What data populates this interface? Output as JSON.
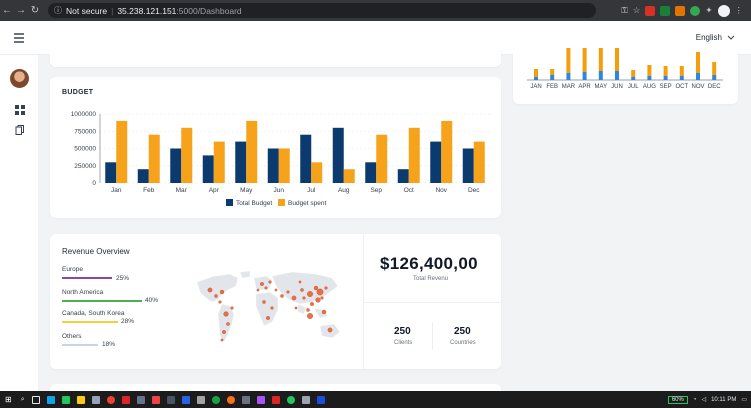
{
  "browser": {
    "security_label": "Not secure",
    "host": "35.238.121.151",
    "path": ":5000/Dashboard"
  },
  "topbar": {
    "language": "English"
  },
  "monthly_chart": {
    "months": [
      "JAN",
      "FEB",
      "MAR",
      "APR",
      "MAY",
      "JUN",
      "JUL",
      "AUG",
      "SEP",
      "OCT",
      "NOV",
      "DEC"
    ],
    "colors": {
      "top": "#f59e0b",
      "bottom": "#2e86de"
    }
  },
  "budget": {
    "title": "BUDGET",
    "legend_total": "Total Budget",
    "legend_spent": "Budget spent"
  },
  "chart_data": {
    "type": "bar",
    "categories": [
      "Jan",
      "Feb",
      "Mar",
      "Apr",
      "May",
      "Jun",
      "Jul",
      "Aug",
      "Sep",
      "Oct",
      "Nov",
      "Dec"
    ],
    "series": [
      {
        "name": "Total Budget",
        "color": "#0b3a6e",
        "values": [
          300000,
          200000,
          500000,
          400000,
          600000,
          500000,
          700000,
          800000,
          300000,
          200000,
          600000,
          500000
        ]
      },
      {
        "name": "Budget spent",
        "color": "#f7a21b",
        "values": [
          900000,
          700000,
          800000,
          600000,
          900000,
          500000,
          300000,
          200000,
          700000,
          800000,
          900000,
          600000
        ]
      }
    ],
    "ylim": [
      0,
      1000000
    ],
    "yticks": [
      "0",
      "250000",
      "500000",
      "750000",
      "1000000"
    ],
    "grid": true,
    "legend": "bottom-center"
  },
  "revenue": {
    "title": "Revenue Overview",
    "regions": [
      {
        "name": "Europe",
        "pct": "25%",
        "color": "#8e44ad",
        "value": 25
      },
      {
        "name": "North America",
        "pct": "40%",
        "color": "#4caf50",
        "value": 40
      },
      {
        "name": "Canada, South Korea",
        "pct": "28%",
        "color": "#f4d03f",
        "value": 28
      },
      {
        "name": "Others",
        "pct": "18%",
        "color": "#cbd5e1",
        "value": 18
      }
    ],
    "total_amount": "$126,400,00",
    "total_label": "Total Revenu",
    "clients_value": "250",
    "clients_label": "Clients",
    "countries_value": "250",
    "countries_label": "Countries"
  },
  "map": {
    "land_color": "#e2e6ea",
    "bubble_color": "#e8603c"
  },
  "taskbar": {
    "battery": "60%",
    "time": "10:11 PM"
  }
}
